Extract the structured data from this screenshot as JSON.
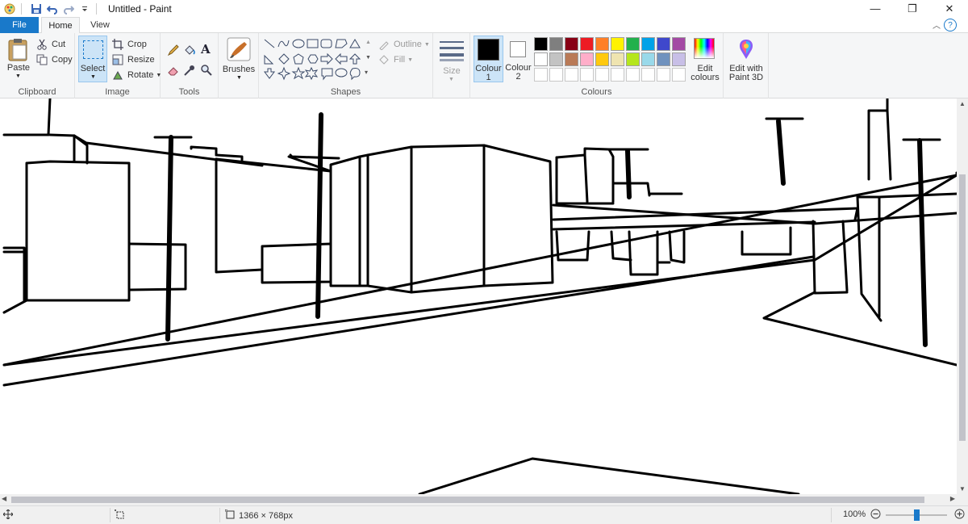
{
  "window": {
    "title": "Untitled - Paint",
    "minimize_label": "—",
    "maximize_label": "❐",
    "close_label": "✕"
  },
  "tabs": {
    "file": "File",
    "home": "Home",
    "view": "View"
  },
  "ribbon": {
    "clipboard": {
      "label": "Clipboard",
      "paste": "Paste",
      "cut": "Cut",
      "copy": "Copy"
    },
    "image": {
      "label": "Image",
      "select": "Select",
      "crop": "Crop",
      "resize": "Resize",
      "rotate": "Rotate"
    },
    "tools": {
      "label": "Tools",
      "text_tool": "A"
    },
    "brushes": {
      "label": "Brushes"
    },
    "shapes": {
      "label": "Shapes",
      "outline": "Outline",
      "fill": "Fill"
    },
    "size": {
      "label": "Size"
    },
    "colours": {
      "label": "Colours",
      "colour1": "Colour 1",
      "colour2": "Colour 2",
      "colour1_value": "#000000",
      "colour2_value": "#ffffff",
      "edit_colours": "Edit colours",
      "palette_row1": [
        "#000000",
        "#7f7f7f",
        "#880015",
        "#ed1c24",
        "#ff7f27",
        "#fff200",
        "#22b14c",
        "#00a2e8",
        "#3f48cc",
        "#a349a4"
      ],
      "palette_row2": [
        "#ffffff",
        "#c3c3c3",
        "#b97a57",
        "#ffaec9",
        "#ffc90e",
        "#efe4b0",
        "#b5e61d",
        "#99d9ea",
        "#7092be",
        "#c8bfe7"
      ]
    },
    "paint3d": {
      "label": "Edit with Paint 3D"
    }
  },
  "status": {
    "canvas_size": "1366 × 768px",
    "zoom": "100%"
  }
}
